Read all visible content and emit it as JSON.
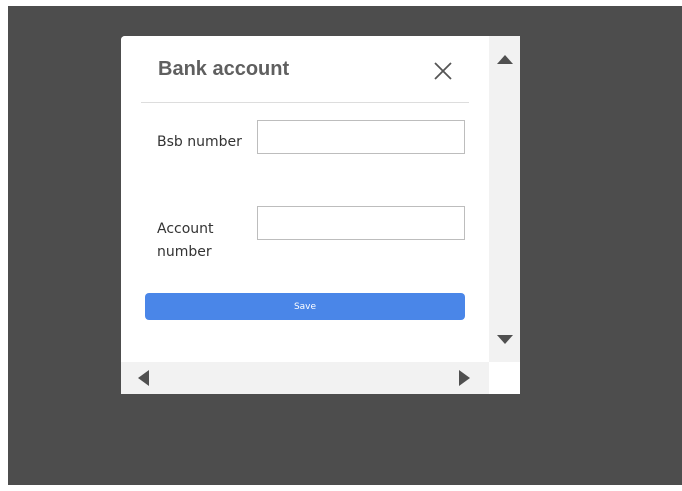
{
  "dialog": {
    "title": "Bank account",
    "close_icon": "close-icon",
    "fields": [
      {
        "label": "Bsb number",
        "value": "",
        "placeholder": ""
      },
      {
        "label": "Account number",
        "value": "",
        "placeholder": ""
      }
    ],
    "save_label": "Save"
  },
  "colors": {
    "backdrop": "#4d4d4d",
    "primary_button": "#4a86e8",
    "title_text": "#5f5f5f",
    "scroll_arrow": "#505050"
  },
  "scrollbars": {
    "up_icon": "triangle-up-icon",
    "down_icon": "triangle-down-icon",
    "left_icon": "triangle-left-icon",
    "right_icon": "triangle-right-icon"
  }
}
